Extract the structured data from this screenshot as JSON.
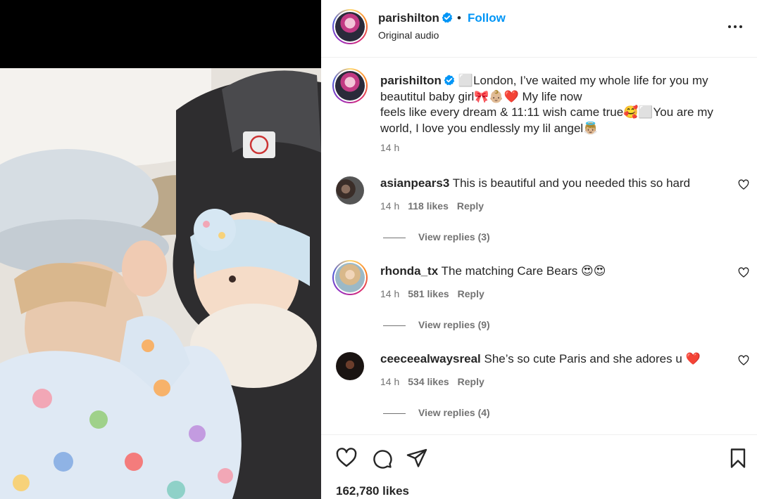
{
  "post": {
    "author": "parishilton",
    "separator": "•",
    "follow_label": "Follow",
    "audio": "Original audio"
  },
  "caption": {
    "user": "parishilton",
    "line1": "⬜London, I’ve waited my whole life for you my",
    "line2": "beautitul baby girl🎀👶🏼❤️  My life now",
    "line3": "feels like every dream & 11:11 wish came true🥰⬜You are my",
    "line4": "world, I love you endlessly my lil angel👼🏼",
    "time": "14 h"
  },
  "comments": [
    {
      "user": "asianpears3",
      "text": "This is beautiful and you needed this so hard",
      "time": "14 h",
      "likes": "118 likes",
      "reply": "Reply",
      "view_replies": "View replies (3)"
    },
    {
      "user": "rhonda_tx",
      "text": "The matching Care Bears 😍😍",
      "time": "14 h",
      "likes": "581 likes",
      "reply": "Reply",
      "view_replies": "View replies (9)"
    },
    {
      "user": "ceeceealwaysreal",
      "text": "She’s so cute Paris and she adores u ❤️",
      "time": "14 h",
      "likes": "534 likes",
      "reply": "Reply",
      "view_replies": "View replies (4)"
    }
  ],
  "likes_total": "162,780 likes",
  "icons": {
    "verified": "verified-badge-icon",
    "more": "more-options-icon",
    "like": "heart-icon",
    "comment": "comment-icon",
    "share": "share-icon",
    "save": "bookmark-icon"
  },
  "colors": {
    "link": "#0095f6",
    "verified": "#0095f6",
    "text": "#262626",
    "secondary": "#737373"
  }
}
